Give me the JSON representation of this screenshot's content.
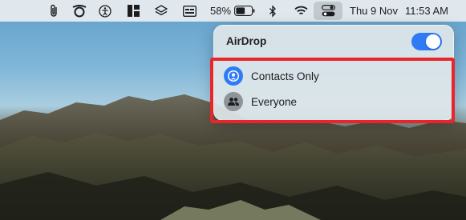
{
  "menubar": {
    "icons": [
      "paperclip-icon",
      "logitech-icon",
      "accessibility-icon",
      "layout-icon",
      "layers-icon",
      "display-icon",
      "battery-icon",
      "bluetooth-icon",
      "wifi-icon",
      "control-center-icon"
    ],
    "battery_percent": "58%",
    "battery_level": 0.58,
    "date": "Thu 9 Nov",
    "time": "11:53 AM"
  },
  "airdrop": {
    "title": "AirDrop",
    "enabled": true,
    "toggle_color": "#2f7bf6",
    "options": [
      {
        "label": "Contacts Only",
        "icon": "contact-icon",
        "selected": true
      },
      {
        "label": "Everyone",
        "icon": "people-icon",
        "selected": false
      }
    ]
  },
  "annotation": {
    "color": "#e8252b"
  }
}
